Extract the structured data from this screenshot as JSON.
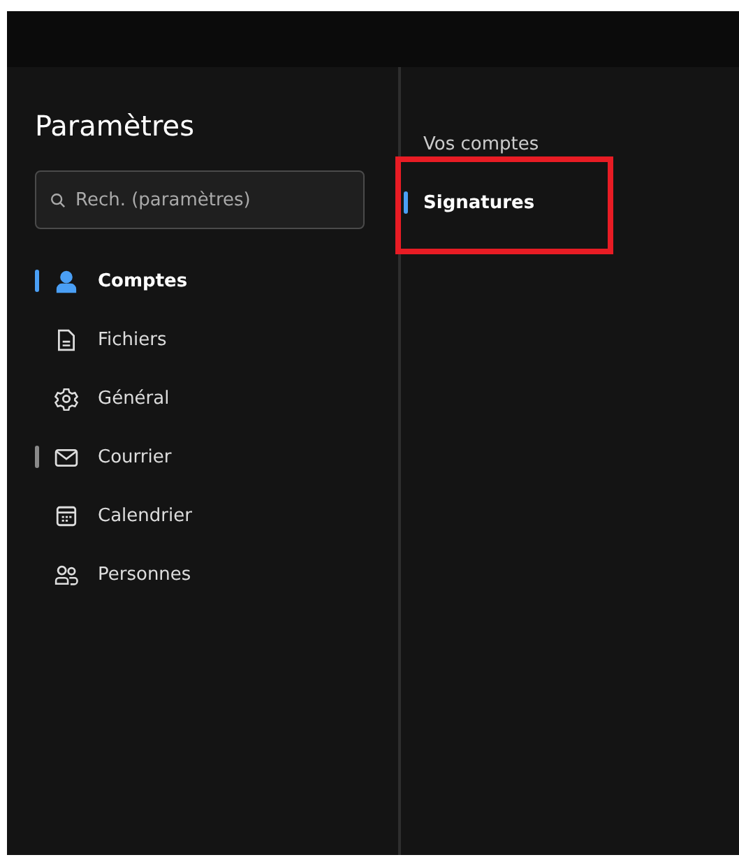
{
  "sidebar": {
    "title": "Paramètres",
    "search": {
      "placeholder": "Rech. (paramètres)"
    },
    "items": [
      {
        "label": "Comptes",
        "selected": true,
        "hovered": false
      },
      {
        "label": "Fichiers",
        "selected": false,
        "hovered": false
      },
      {
        "label": "Général",
        "selected": false,
        "hovered": false
      },
      {
        "label": "Courrier",
        "selected": false,
        "hovered": true
      },
      {
        "label": "Calendrier",
        "selected": false,
        "hovered": false
      },
      {
        "label": "Personnes",
        "selected": false,
        "hovered": false
      }
    ]
  },
  "subnav": {
    "items": [
      {
        "label": "Vos comptes",
        "selected": false,
        "highlighted": false
      },
      {
        "label": "Signatures",
        "selected": true,
        "highlighted": true
      }
    ]
  }
}
